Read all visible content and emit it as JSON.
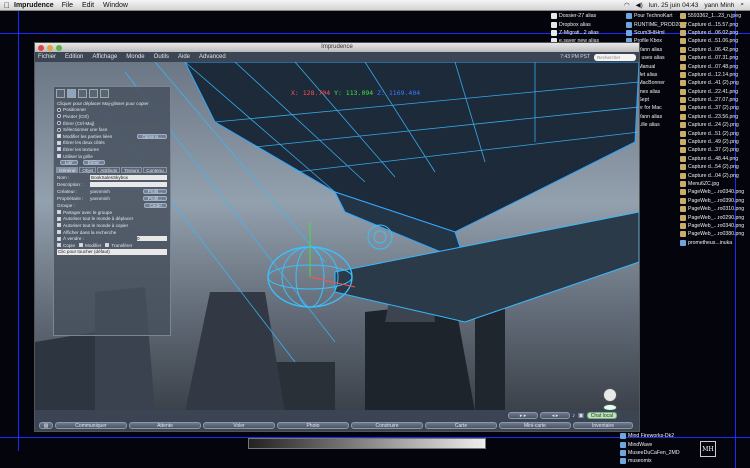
{
  "menubar": {
    "app": "Imprudence",
    "items": [
      "File",
      "Edit",
      "Window"
    ],
    "clock": "lun. 25 juin 04:43",
    "user": "yann Minh"
  },
  "window": {
    "title": "Imprudence",
    "menu": [
      "Fichier",
      "Edition",
      "Affichage",
      "Monde",
      "Outils",
      "Aide",
      "Advanced"
    ],
    "status": "7:43 PM PST",
    "search_placeholder": "Rechercher",
    "coords": {
      "x": "X: 128.704",
      "y": "Y: 113.094",
      "z": "Z: 1169.404"
    }
  },
  "panel": {
    "lines": [
      "Cliquer pour déplacer  Maj-glisser pour copier",
      "Positionner",
      "Pivoter (Ctrl)",
      "Étirer (Ctrl-Maj)",
      "Sélectionner une face",
      "Modifier les parties liées"
    ],
    "checks": [
      "Étirer les deux côtés",
      "Étirer les textures",
      "Utiliser la grille"
    ],
    "options_btn": "Options...",
    "link_btn": "Lier",
    "unlink_btn": "Délier",
    "tabs": [
      "Général",
      "Objet",
      "Attributs",
      "Texture",
      "Contenu"
    ],
    "fields": [
      {
        "label": "Nom :",
        "value": "BookSalesSkybox"
      },
      {
        "label": "Description :",
        "value": ""
      },
      {
        "label": "Créateur :",
        "value": "yannminh"
      },
      {
        "label": "Propriétaire :",
        "value": "yannminh"
      },
      {
        "label": "Groupe :",
        "value": ""
      }
    ],
    "profile_btn": "Profil...",
    "deed_btn": "Céder",
    "share_label": "Partager avec le groupe",
    "permissions": [
      "Autoriser tout le monde à déplacer",
      "Autoriser tout le monde à copier",
      "Afficher dans la recherche",
      "À vendre :",
      "Copie",
      "Modifier",
      "Transférer"
    ],
    "price": "0",
    "click_action": "Clic pour toucher (défaut)"
  },
  "viewer_bottom": {
    "chat_local": "Chat local",
    "buttons": [
      "Communiquer",
      "Attente",
      "Voler",
      "Photo",
      "Construire",
      "Carte",
      "Mini-carte",
      "Inventaire"
    ],
    "counter": "21"
  },
  "desktop_icons": {
    "col1": [
      "Pour TechnoKart",
      "RUNTIME_PROD2012",
      "Scum3HtHml",
      "Profile Kbox",
      "...Yann alias",
      "...r uses alias",
      "...Manual",
      "...Jet alias",
      "...MacBonner",
      "...mes alias",
      "...Sept",
      "...er for Mac",
      "...Yann alias",
      "...Lille alias",
      "...",
      "5593362_1...23_n.jpeg",
      "Capture d...15.57.png",
      "Capture d...06.02.png",
      "Capture d...51.06.png",
      "Capture d...06.42.png",
      "Capture d...07.31.png",
      "Capture d...07.48.png",
      "Capture d...12.14.png",
      "Capture d...41 (2).png",
      "Capture d...22.41.png",
      "Capture d...27.07.png",
      "Capture d...37 (2).png",
      "Capture d...23.56.png",
      "Capture d...24 (2).png",
      "Capture d...51 (2).png",
      "Capture d...49 (2).png",
      "Capture d...37 (2).png",
      "Capture d...48.44.png",
      "Capture d...54 (2).png",
      "Capture d...04 (2).png",
      "Menu6ZC.jpg",
      "PageWeb_...ro0340.png",
      "PageWeb_...ro0390.png",
      "PageWeb_...ro0310.png",
      "PageWeb_...ro0290.png",
      "PageWeb_...ro0340.png",
      "PageWeb_...ro0380.png",
      "prometheus...inuka"
    ],
    "col2": [
      "Dossier-27 alias",
      "Dropbox alias",
      "Z-Migrati...2 alias",
      "e.saver new alias",
      "...",
      "AEG alias",
      "...AEG alias",
      "12Cosurs",
      "12CosursHD2",
      "12CosursHD3",
      "12CosursHD4",
      "BOOTCAMP",
      "FAT32",
      "SHDUKKOSA",
      "SOBJETS3D",
      "SSOFTS",
      "STEXTURES",
      "X-Hadaly",
      "X-Ghost",
      "10--soumone",
      "Delphin V...3 Installer",
      "Firestorm Installer",
      "monstock 1"
    ]
  },
  "dock_left": [
    "Mind Fireworks-Dk2",
    "MindWave",
    "MuseeDuCaFen_2MD",
    "museomix"
  ]
}
